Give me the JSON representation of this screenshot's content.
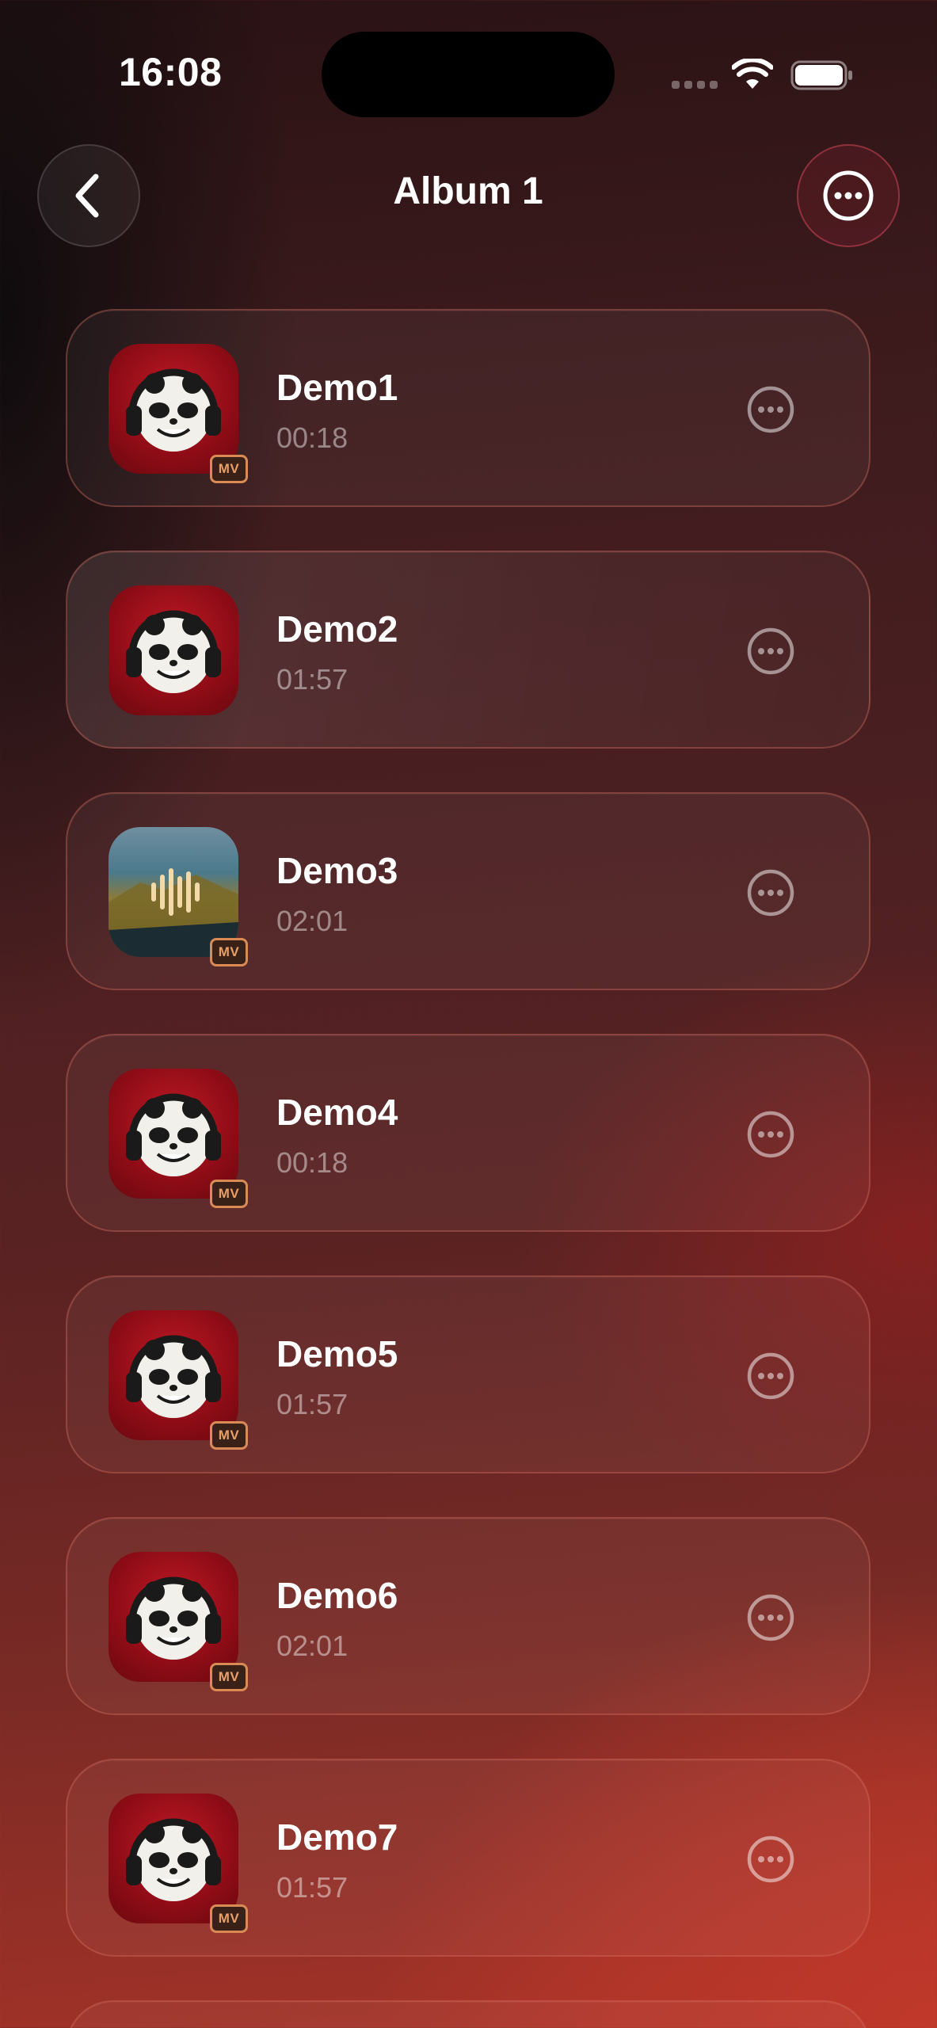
{
  "status_bar": {
    "time": "16:08",
    "wifi_icon": "wifi-icon",
    "battery_icon": "battery-icon"
  },
  "nav": {
    "back_icon": "chevron-left-icon",
    "title": "Album 1",
    "more_icon": "ellipsis-circle-icon"
  },
  "tracks": [
    {
      "title": "Demo1",
      "duration": "00:18",
      "cover": "panda-headphones",
      "badge": "MV"
    },
    {
      "title": "Demo2",
      "duration": "01:57",
      "cover": "panda-headphones",
      "badge": ""
    },
    {
      "title": "Demo3",
      "duration": "02:01",
      "cover": "landscape-waveform",
      "badge": "MV"
    },
    {
      "title": "Demo4",
      "duration": "00:18",
      "cover": "panda-headphones",
      "badge": "MV"
    },
    {
      "title": "Demo5",
      "duration": "01:57",
      "cover": "panda-headphones",
      "badge": "MV"
    },
    {
      "title": "Demo6",
      "duration": "02:01",
      "cover": "panda-headphones",
      "badge": "MV"
    },
    {
      "title": "Demo7",
      "duration": "01:57",
      "cover": "panda-headphones",
      "badge": "MV"
    }
  ],
  "colors": {
    "accent_border": "#d76e5f",
    "badge_border": "#d98a55",
    "badge_text": "#e8a06a",
    "cover_red": "#a8121d"
  }
}
